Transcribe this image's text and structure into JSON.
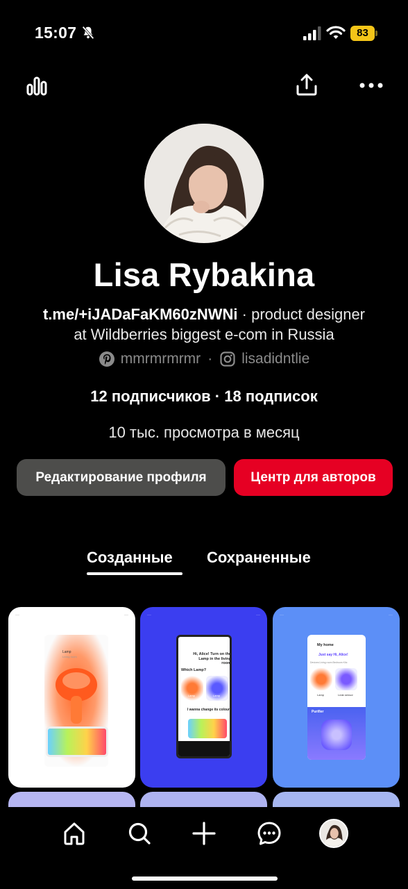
{
  "status_bar": {
    "time": "15:07",
    "battery": "83",
    "icons": [
      "bell-slash-icon",
      "signal-icon",
      "wifi-icon",
      "battery-icon"
    ]
  },
  "top_bar": {
    "icons": [
      "stats-icon",
      "share-icon",
      "more-icon"
    ]
  },
  "profile": {
    "name": "Lisa Rybakina",
    "bio_link": "t.me/+iJADaFaKM60zNWNi",
    "bio_sep": " · ",
    "bio_text_1": "product designer",
    "bio_text_2": "at Wildberries biggest e-com in Russia",
    "pinterest_handle": "mmrmrmrmr",
    "social_sep": "·",
    "instagram_handle": "lisadidntlie",
    "followers": "12 подписчиков · 18 подписок",
    "views": "10 тыс. просмотра в месяц"
  },
  "buttons": {
    "edit_profile": "Редактирование профиля",
    "creator_center": "Центр для авторов"
  },
  "tabs": {
    "created": "Созданные",
    "saved": "Сохраненные",
    "active": "created"
  },
  "pins": [
    {
      "bg": "#ffffff",
      "title": "Lamp",
      "subtitle": "Living room"
    },
    {
      "bg": "#3b3ef0",
      "title": "Hi, Alice! Turn on the Lamp in the living room",
      "question": "Which Lamp?",
      "option_1": "Lamp",
      "option_2": "Lamp",
      "footer": "I wanna change its colour"
    },
    {
      "bg": "#5c8ff7",
      "title": "My home",
      "greeting": "Just say Hi, Alice!",
      "tabs": "Devices  Living room  Bedroom  Kitc",
      "option_1": "Lamp",
      "option_2": "Leak sensor",
      "device": "Purifier"
    }
  ],
  "bottom_nav": {
    "items": [
      "home-icon",
      "search-icon",
      "plus-icon",
      "messages-icon",
      "profile-avatar"
    ]
  },
  "colors": {
    "accent": "#e60023",
    "secondary_button": "#4d4d4b",
    "background": "#000000"
  }
}
